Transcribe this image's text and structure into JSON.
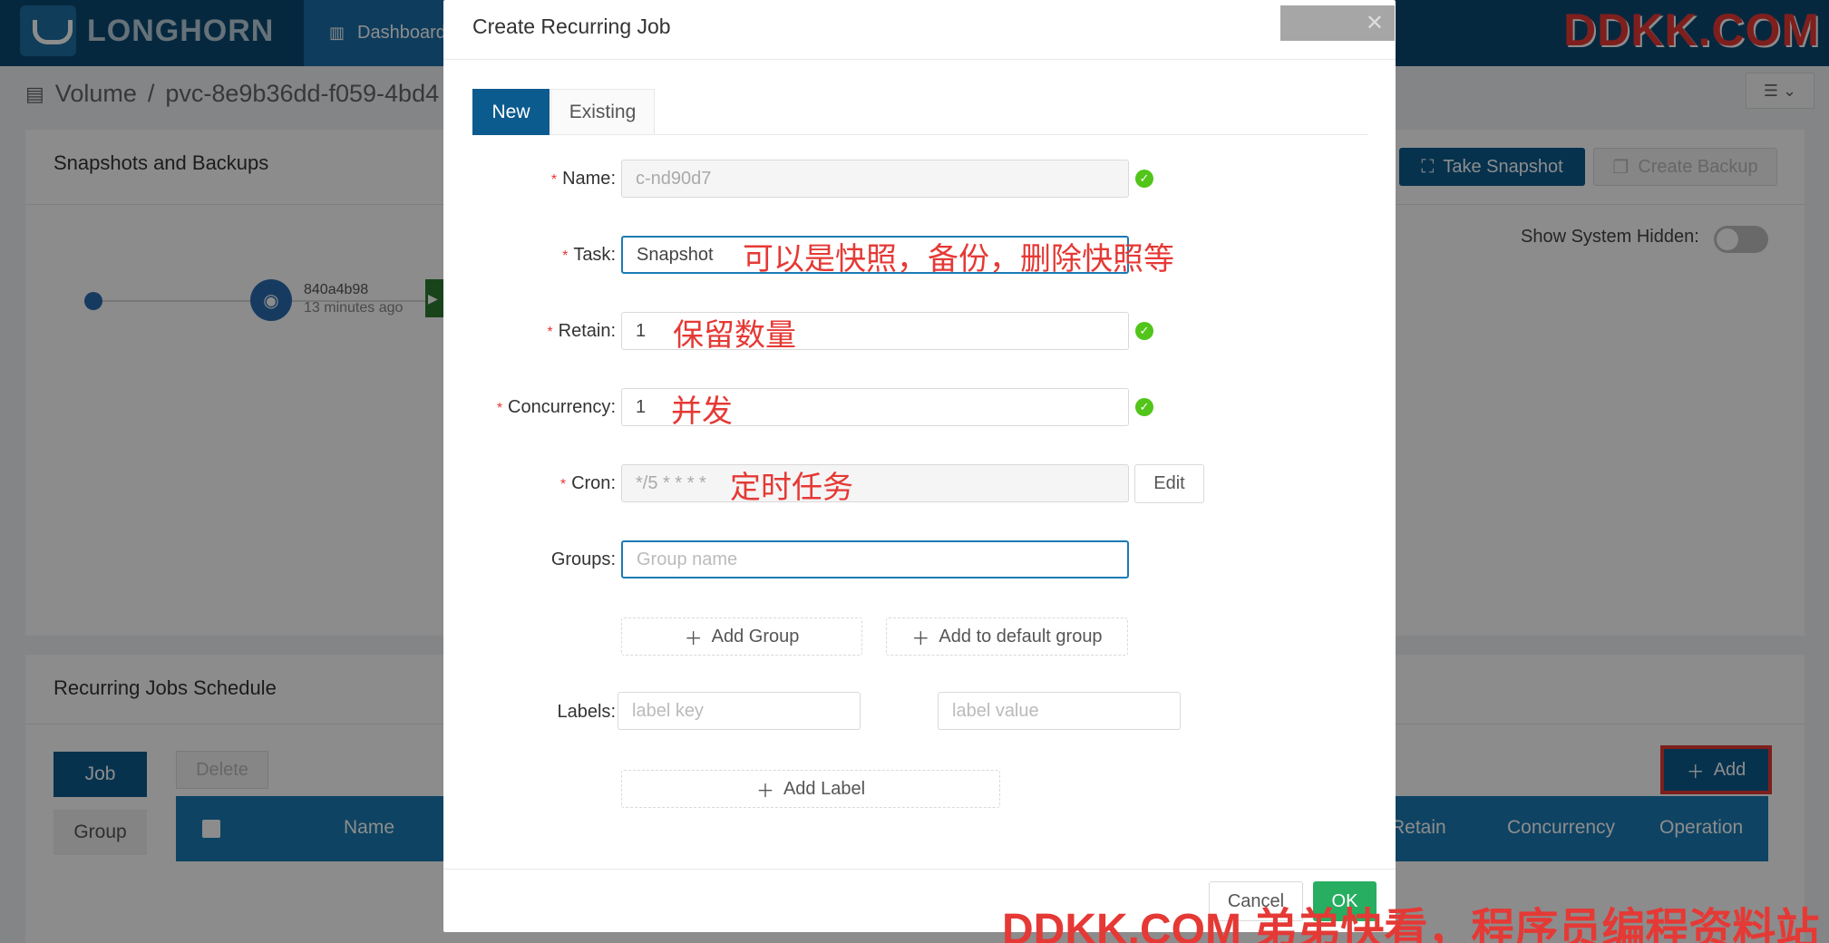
{
  "app": {
    "logo_text": "LONGHORN",
    "nav_dashboard": "Dashboard",
    "watermark_top": "DDKK.COM",
    "watermark_bottom": "DDKK.COM 弟弟快看，程序员编程资料站"
  },
  "breadcrumb": {
    "root": "Volume",
    "separator": "/",
    "current": "pvc-8e9b36dd-f059-4bd4"
  },
  "snapshots_panel": {
    "title": "Snapshots and Backups",
    "take_snapshot": "Take Snapshot",
    "create_backup": "Create Backup",
    "show_system_hidden": "Show System Hidden:",
    "snapshot_name": "840a4b98",
    "snapshot_time": "13 minutes ago"
  },
  "recurring_panel": {
    "title": "Recurring Jobs Schedule",
    "tabs": [
      "Job",
      "Group"
    ],
    "delete": "Delete",
    "add": "Add",
    "columns": [
      "Name",
      "Retain",
      "Concurrency",
      "Operation"
    ]
  },
  "modal": {
    "title": "Create Recurring Job",
    "tabs": [
      "New",
      "Existing"
    ],
    "fields": {
      "name": {
        "label": "Name",
        "value": "c-nd90d7"
      },
      "task": {
        "label": "Task",
        "value": "Snapshot",
        "annotation": "可以是快照，备份，删除快照等"
      },
      "retain": {
        "label": "Retain",
        "value": "1",
        "annotation": "保留数量"
      },
      "concurrency": {
        "label": "Concurrency",
        "value": "1",
        "annotation": "并发"
      },
      "cron": {
        "label": "Cron",
        "value": "*/5 * * * *",
        "annotation": "定时任务",
        "edit": "Edit"
      },
      "groups": {
        "label": "Groups",
        "placeholder": "Group name"
      },
      "labels": {
        "label": "Labels",
        "key_placeholder": "label key",
        "value_placeholder": "label value"
      }
    },
    "add_group": "Add Group",
    "add_default_group": "Add to default group",
    "add_label": "Add Label",
    "cancel": "Cancel",
    "ok": "OK"
  },
  "colors": {
    "primary": "#0c5b8f",
    "header": "#0c4a73",
    "success": "#52c41a",
    "ok_button": "#27ae60",
    "annotation": "#e53935"
  }
}
